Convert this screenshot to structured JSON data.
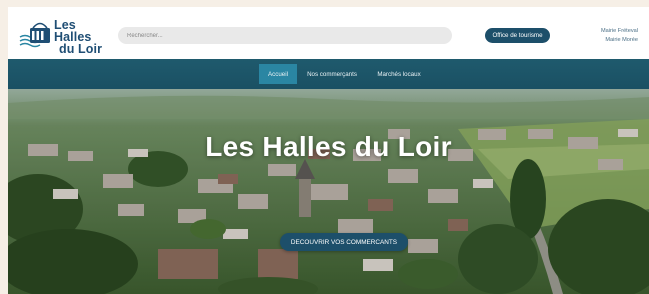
{
  "brand": {
    "line1": "Les Halles",
    "line2": "du Loir"
  },
  "search": {
    "placeholder": "Rechercher..."
  },
  "header": {
    "office_label": "Office de tourisme",
    "mairies": [
      "Mairie Fréteval",
      "Mairie Morée"
    ]
  },
  "nav": {
    "items": [
      {
        "label": "Accueil",
        "active": true
      },
      {
        "label": "Nos commerçants",
        "active": false
      },
      {
        "label": "Marchés locaux",
        "active": false
      }
    ]
  },
  "hero": {
    "title": "Les Halles du Loir",
    "cta_label": "DECOUVRIR VOS COMMERCANTS"
  },
  "colors": {
    "primary": "#1d4f6a",
    "nav_bg": "#1f5a6d",
    "nav_active": "#2a86a3",
    "brand_text": "#1f4e74"
  }
}
